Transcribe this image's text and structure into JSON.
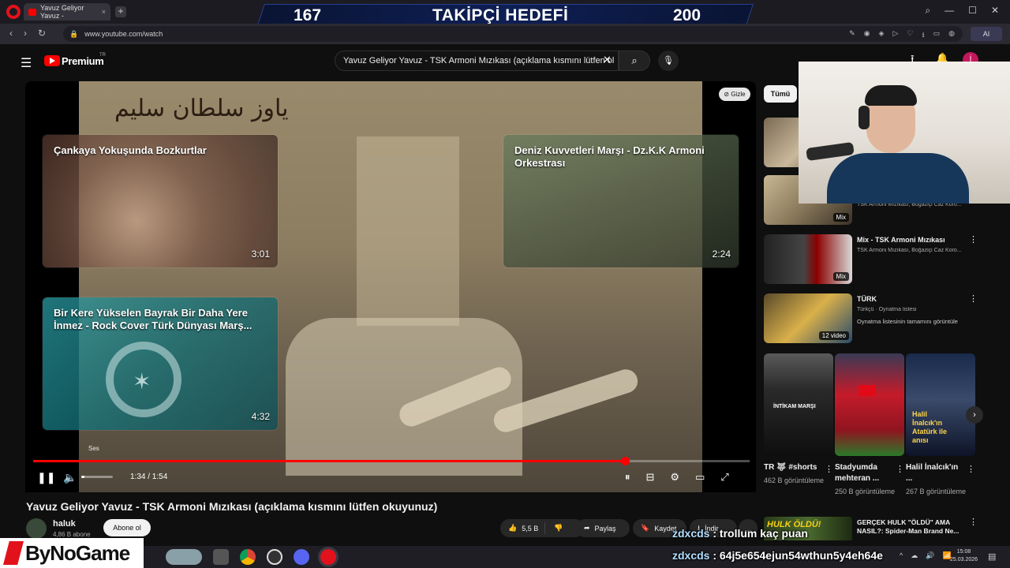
{
  "browser": {
    "tab_title": "Yavuz Geliyor Yavuz -",
    "tab_close": "×",
    "new_tab": "+",
    "url": "www.youtube.com/watch",
    "ai_label": "AI",
    "window_controls": [
      "⌕",
      "—",
      "☐",
      "✕"
    ],
    "nav": [
      "‹",
      "›",
      "↻"
    ]
  },
  "goal_overlay": {
    "current": "167",
    "title": "TAKİPÇİ HEDEFİ",
    "target": "200"
  },
  "youtube_header": {
    "brand": "Premium",
    "brand_sup": "TR",
    "search_query": "Yavuz Geliyor Yavuz - TSK Armoni Mızıkası (açıklama kısmını lütfen ol",
    "clear_icon": "✕",
    "search_icon": "⌕",
    "mic_icon": "🎙",
    "avatar_letter": "İ",
    "hamburger_icon": "☰",
    "upload_icon": "⭱",
    "bell_icon": "🔔"
  },
  "player": {
    "calligraphy": "یاوز سلطان سلیم",
    "hide_label": "Gizle",
    "volume_tooltip": "Ses",
    "time": "1:34 / 1:54",
    "progress_fraction": 0.826,
    "volume_fraction": 0.1,
    "play_icon": "❚❚",
    "volume_icon": "🔈",
    "right_controls": [
      "⏸",
      "⊟",
      "⚙",
      "▭",
      "⤢"
    ],
    "end_screens": [
      {
        "title": "Çankaya Yokuşunda Bozkurtlar",
        "duration": "3:01"
      },
      {
        "title": "Deniz Kuvvetleri Marşı - Dz.K.K Armoni Orkestrası",
        "duration": "2:24"
      },
      {
        "title": "Bir Kere Yükselen Bayrak Bir Daha Yere İnmez - Rock Cover Türk Dünyası Marş...",
        "duration": "4:32"
      }
    ]
  },
  "video_info": {
    "title": "Yavuz Geliyor Yavuz - TSK Armoni Mızıkası (açıklama kısmını lütfen okuyunuz)",
    "channel": "haluk",
    "subscribers": "4,86 B abone",
    "subscribe_label": "Abone ol",
    "likes": "5,5 B",
    "share_label": "Paylaş",
    "save_label": "Kaydet",
    "download_label": "İndir",
    "more_label": "…"
  },
  "sidebar": {
    "chip_all": "Tümü",
    "items": [
      {
        "title": "",
        "meta": "",
        "badge": ""
      },
      {
        "title": "",
        "meta": "TSK Armoni Mızıkası, Boğaziçi Caz Koro...",
        "badge": "Mix"
      },
      {
        "title": "Mix - TSK Armoni Mızıkası",
        "meta": "TSK Armoni Mızıkası, Boğaziçi Caz Koro...",
        "badge": "Mix"
      },
      {
        "title": "TÜRK",
        "meta": "Türkçü · Oynatma listesi",
        "meta2": "Oynatma listesinin tamamını görüntüle",
        "badge": "12 video"
      }
    ],
    "shorts": [
      {
        "title": "TR 🐺 #shorts",
        "views": "462 B görüntüleme",
        "overlay": "İNTİKAM MARŞI"
      },
      {
        "title": "Stadyumda mehteran ...",
        "views": "250 B görüntüleme",
        "overlay": ""
      },
      {
        "title": "Halil İnalcık'ın ...",
        "views": "267 B görüntüleme",
        "overlay": "Halil İnalcık'ın Atatürk ile anısı"
      }
    ],
    "hulk": {
      "thumb_text": "HULK ÖLDÜ!",
      "title": "GERÇEK HULK \"ÖLDÜ\" AMA NASIL?: Spider-Man Brand Ne..."
    },
    "kebab_icon": "⋮",
    "next_icon": "›"
  },
  "chat": [
    {
      "user": "zdxcds",
      "message": ": trollum kaç puan"
    },
    {
      "user": "zdxcds",
      "message": ": 64j5e654ejun54wthun5y4eh64e"
    }
  ],
  "taskbar": {
    "brand": "ByNoGame",
    "time": "15:08",
    "date": "25.03.2026",
    "tray": [
      "^",
      "☁",
      "🔊",
      "📶"
    ],
    "notify_icon": "▤"
  }
}
